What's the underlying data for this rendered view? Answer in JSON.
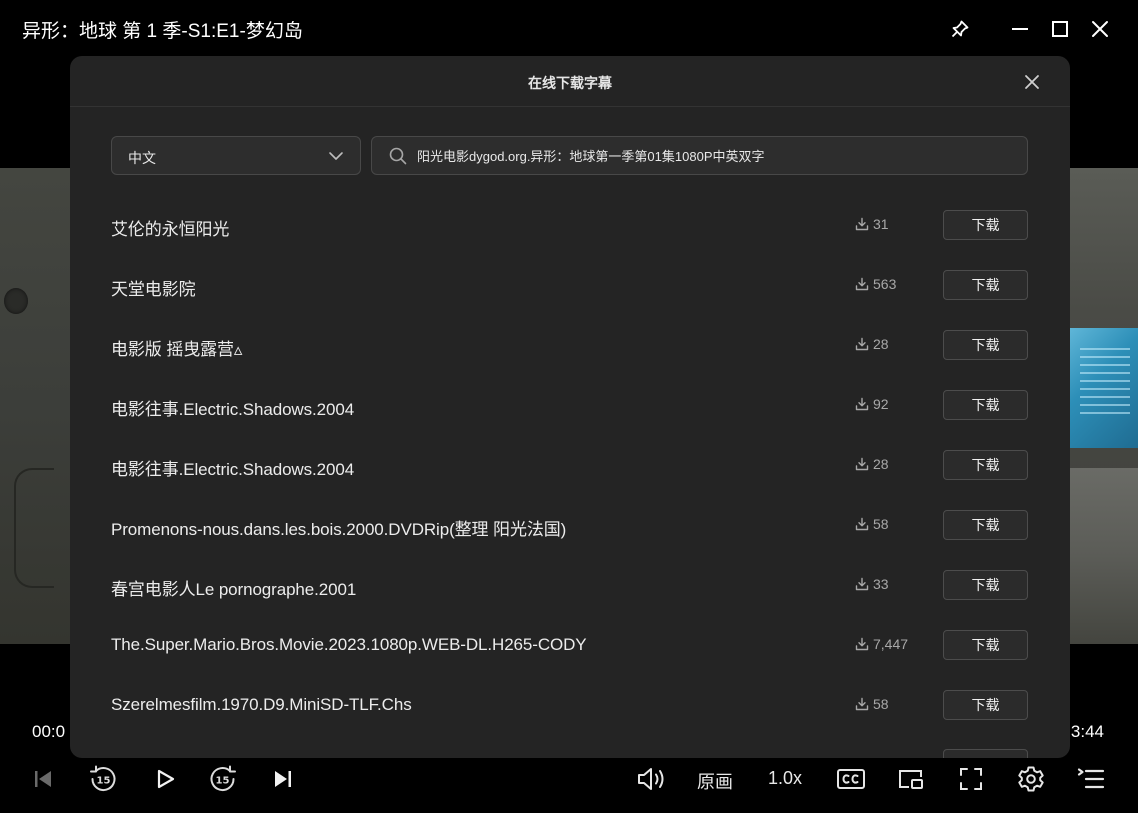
{
  "window": {
    "title": "异形：地球 第 1 季-S1:E1-梦幻岛"
  },
  "dialog": {
    "title": "在线下载字幕",
    "language": "中文",
    "search_value": "阳光电影dygod.org.异形：地球第一季第01集1080P中英双字",
    "download_label": "下载",
    "subtitles": [
      {
        "name": "艾伦的永恒阳光",
        "downloads": "31"
      },
      {
        "name": "天堂电影院",
        "downloads": "563"
      },
      {
        "name": "电影版 摇曳露营▵",
        "downloads": "28"
      },
      {
        "name": "电影往事.Electric.Shadows.2004",
        "downloads": "92"
      },
      {
        "name": "电影往事.Electric.Shadows.2004",
        "downloads": "28"
      },
      {
        "name": "Promenons-nous.dans.les.bois.2000.DVDRip(整理 阳光法国)",
        "downloads": "58"
      },
      {
        "name": "春宫电影人Le pornographe.2001",
        "downloads": "33"
      },
      {
        "name": "The.Super.Mario.Bros.Movie.2023.1080p.WEB-DL.H265-CODY",
        "downloads": "7,447"
      },
      {
        "name": "Szerelmesfilm.1970.D9.MiniSD-TLF.Chs",
        "downloads": "58"
      }
    ]
  },
  "player": {
    "time_elapsed": "00:0",
    "time_total": "3:44",
    "quality_label": "原画",
    "speed_label": "1.0x"
  },
  "icons": {
    "pin": "pin-icon",
    "minimize": "minimize-icon",
    "maximize": "maximize-icon",
    "close": "close-icon",
    "previous": "skip-previous-icon",
    "rewind": "rewind-15-icon",
    "play": "play-icon",
    "forward": "forward-15-icon",
    "next": "skip-next-icon",
    "volume": "volume-icon",
    "subtitles": "cc-icon",
    "pip": "picture-in-picture-icon",
    "fullscreen": "fullscreen-icon",
    "settings": "gear-icon",
    "playlist": "playlist-icon"
  }
}
